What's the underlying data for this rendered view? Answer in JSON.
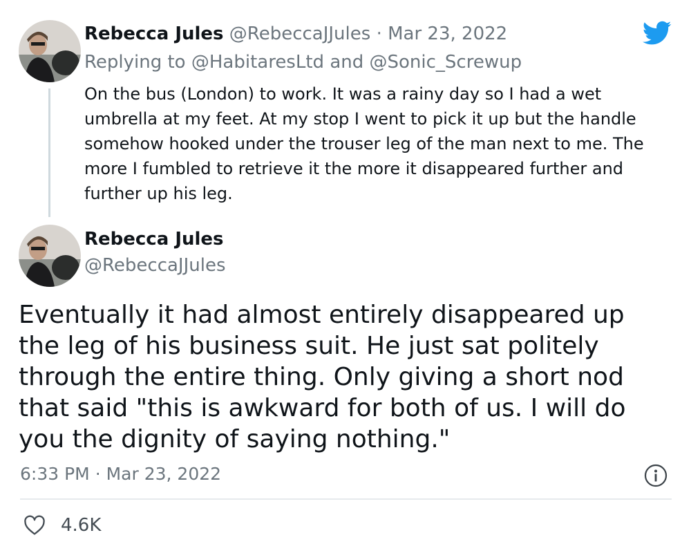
{
  "reply_tweet": {
    "display_name": "Rebecca Jules",
    "handle": "@RebeccaJJules",
    "separator": "·",
    "date": "Mar 23, 2022",
    "replying_prefix": "Replying to",
    "replying_user_1": "@HabitaresLtd",
    "replying_conjunction": "and",
    "replying_user_2": "@Sonic_Screwup",
    "text": "On the bus (London) to work. It was a rainy day so I had a wet umbrella at my feet. At my stop I went to pick it up but the handle somehow hooked under the trouser leg of the man next to me. The more I fumbled to retrieve it the more it disappeared further and further up his leg."
  },
  "main_tweet": {
    "display_name": "Rebecca Jules",
    "handle": "@RebeccaJJules",
    "text": "Eventually it had almost entirely disappeared up the leg of his business suit. He just sat politely through the entire thing. Only giving a short nod that said \"this is awkward for both of us. I will do you the dignity of saying nothing.\"",
    "time": "6:33 PM",
    "separator": "·",
    "date": "Mar 23, 2022",
    "like_count": "4.6K"
  },
  "icons": {
    "brand": "twitter-bird-icon",
    "info": "info-icon",
    "like": "heart-icon"
  },
  "colors": {
    "twitter_blue": "#1d9bf0",
    "text": "#0f1419",
    "muted": "#6b757d",
    "divider": "#e6eaed"
  }
}
